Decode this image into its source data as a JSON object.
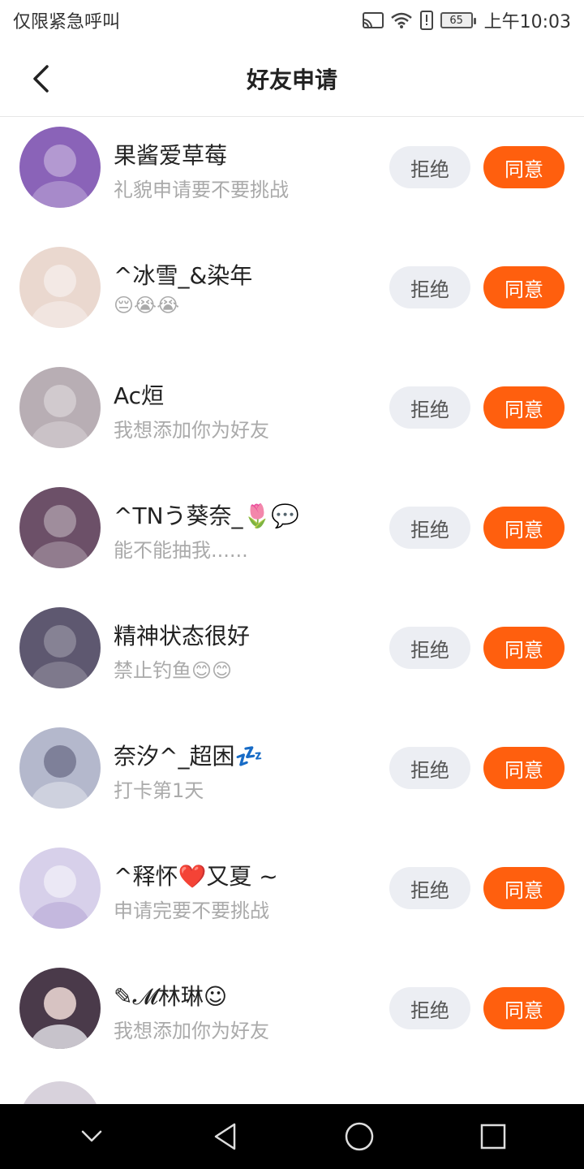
{
  "status_bar": {
    "left_text": "仅限紧急呼叫",
    "battery": "65",
    "time": "上午10:03",
    "icons": [
      "cast-icon",
      "wifi-icon",
      "alert-icon",
      "battery-icon"
    ]
  },
  "header": {
    "title": "好友申请",
    "back_icon": "chevron-left-icon"
  },
  "requests": [
    {
      "name": "果酱爱草莓",
      "message": "礼貌申请要不要挑战",
      "reject_label": "拒绝",
      "accept_label": "同意",
      "avatar_color": "#8a63b8"
    },
    {
      "name": "^冰雪_&染年",
      "message": "😔😭😭",
      "reject_label": "拒绝",
      "accept_label": "同意",
      "avatar_color": "#ead8cf"
    },
    {
      "name": "Ac烜",
      "message": "我想添加你为好友",
      "reject_label": "拒绝",
      "accept_label": "同意",
      "avatar_color": "#b8aeb4"
    },
    {
      "name": "^TNう葵奈_🌷💬",
      "message": "能不能抽我......",
      "reject_label": "拒绝",
      "accept_label": "同意",
      "avatar_color": "#6c5068"
    },
    {
      "name": "精神状态很好",
      "message": "禁止钓鱼😊😊",
      "reject_label": "拒绝",
      "accept_label": "同意",
      "avatar_color": "#5e5870"
    },
    {
      "name": "奈汐^_超困💤",
      "message": "打卡第1天",
      "reject_label": "拒绝",
      "accept_label": "同意",
      "avatar_color": "#b4b8cc"
    },
    {
      "name": "^释怀❤️又夏 ~",
      "message": "申请完要不要挑战",
      "reject_label": "拒绝",
      "accept_label": "同意",
      "avatar_color": "#d7d0ea"
    },
    {
      "name": "✎𝓜林琳☺",
      "message": "我想添加你为好友",
      "reject_label": "拒绝",
      "accept_label": "同意",
      "avatar_color": "#4a3a4a"
    }
  ],
  "nav_bar": {
    "icons": [
      "collapse-chevron-icon",
      "back-triangle-icon",
      "home-circle-icon",
      "recents-square-icon"
    ]
  },
  "colors": {
    "accept": "#ff5f0e",
    "reject_bg": "#eceef3",
    "secondary_text": "#aaaaaa"
  }
}
